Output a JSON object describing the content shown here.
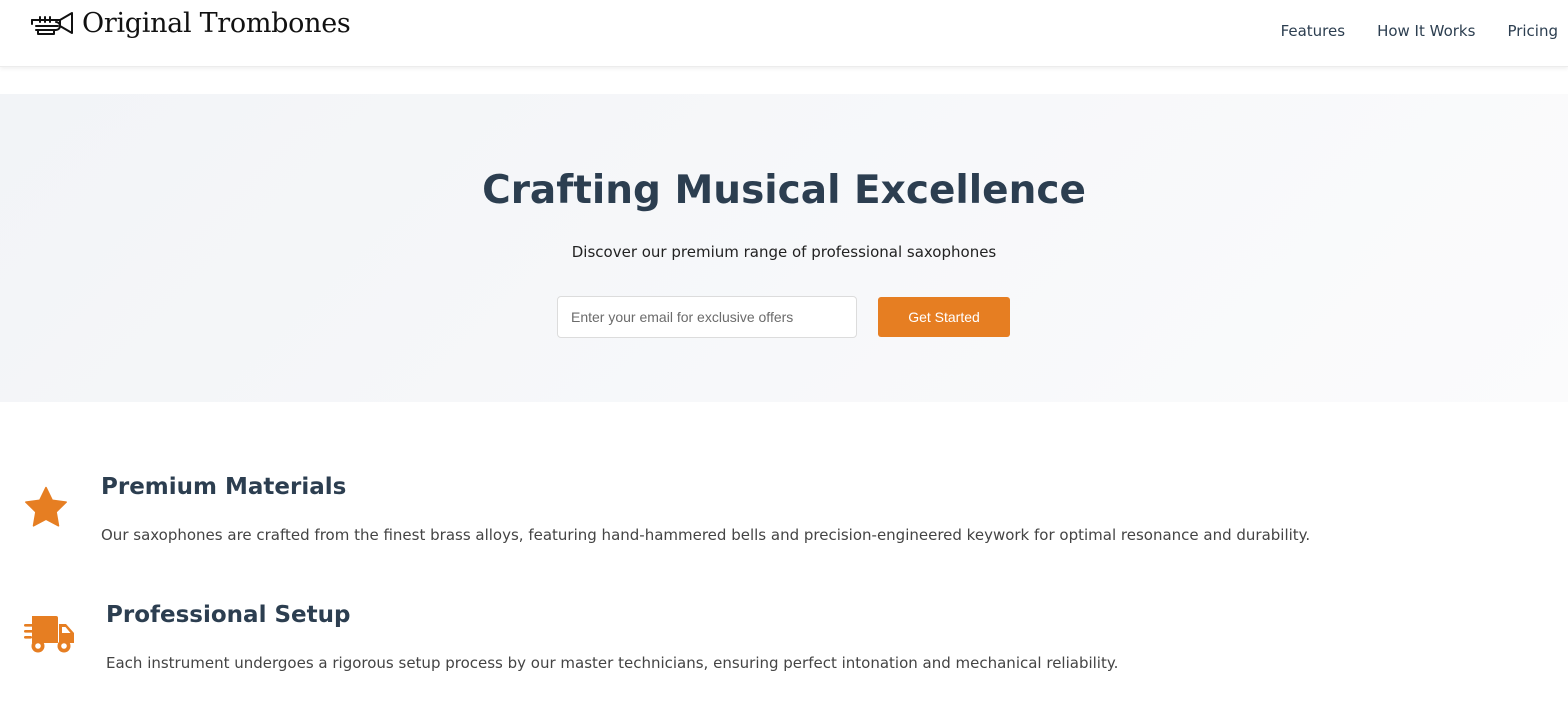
{
  "header": {
    "brand": "Original Trombones",
    "logo_icon": "trombone-icon",
    "nav": [
      {
        "label": "Features"
      },
      {
        "label": "How It Works"
      },
      {
        "label": "Pricing"
      }
    ]
  },
  "hero": {
    "title": "Crafting Musical Excellence",
    "subtitle": "Discover our premium range of professional saxophones",
    "email_placeholder": "Enter your email for exclusive offers",
    "cta_label": "Get Started"
  },
  "features": [
    {
      "icon": "star-icon",
      "title": "Premium Materials",
      "description": "Our saxophones are crafted from the finest brass alloys, featuring hand-hammered bells and precision-engineered keywork for optimal resonance and durability."
    },
    {
      "icon": "shipping-truck-icon",
      "title": "Professional Setup",
      "description": "Each instrument undergoes a rigorous setup process by our master technicians, ensuring perfect intonation and mechanical reliability."
    }
  ],
  "colors": {
    "accent": "#e67e22",
    "heading": "#2c3e50",
    "hero_bg": "#f5f6f8"
  }
}
